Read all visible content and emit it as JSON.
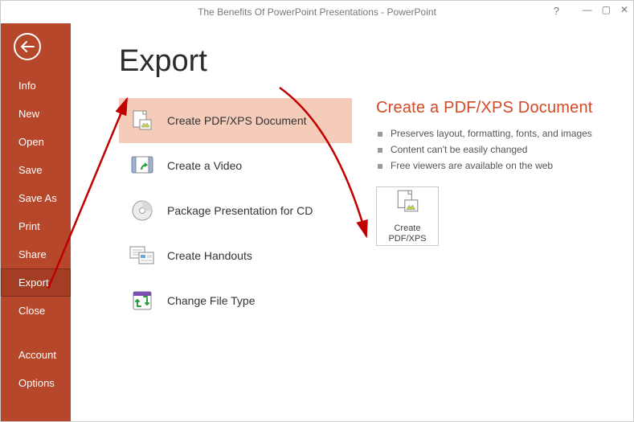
{
  "window": {
    "title": "The Benefits Of PowerPoint Presentations - PowerPoint"
  },
  "sidebar": {
    "items": [
      {
        "label": "Info"
      },
      {
        "label": "New"
      },
      {
        "label": "Open"
      },
      {
        "label": "Save"
      },
      {
        "label": "Save As"
      },
      {
        "label": "Print"
      },
      {
        "label": "Share"
      },
      {
        "label": "Export"
      },
      {
        "label": "Close"
      }
    ],
    "footer": [
      {
        "label": "Account"
      },
      {
        "label": "Options"
      }
    ],
    "selected_index": 7
  },
  "main": {
    "heading": "Export",
    "options": [
      {
        "label": "Create PDF/XPS Document",
        "icon": "pdf-xps-icon"
      },
      {
        "label": "Create a Video",
        "icon": "video-icon"
      },
      {
        "label": "Package Presentation for CD",
        "icon": "cd-icon"
      },
      {
        "label": "Create Handouts",
        "icon": "handouts-icon"
      },
      {
        "label": "Change File Type",
        "icon": "change-filetype-icon"
      }
    ],
    "selected_option": 0
  },
  "detail": {
    "heading": "Create a PDF/XPS Document",
    "bullets": [
      "Preserves layout, formatting, fonts, and images",
      "Content can't be easily changed",
      "Free viewers are available on the web"
    ],
    "button_line1": "Create",
    "button_line2": "PDF/XPS"
  }
}
